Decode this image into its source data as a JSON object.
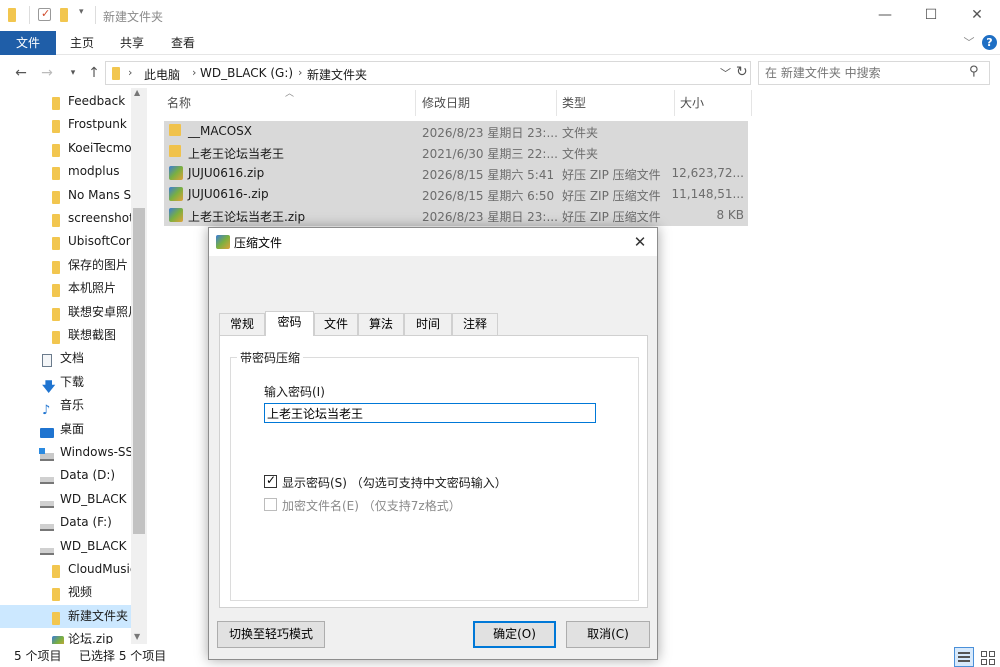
{
  "window": {
    "title": "新建文件夹",
    "controls": {
      "minimize": "—",
      "maximize": "☐",
      "close": "✕"
    }
  },
  "ribbon": {
    "tabs": [
      "文件",
      "主页",
      "共享",
      "查看"
    ],
    "collapse_glyph": "﹀",
    "help_glyph": "?"
  },
  "address": {
    "crumbs": [
      "此电脑",
      "WD_BLACK (G:)",
      "新建文件夹"
    ],
    "search_placeholder": "在 新建文件夹 中搜索"
  },
  "nav": {
    "items": [
      {
        "label": "Feedback",
        "icon": "folder-icon"
      },
      {
        "label": "Frostpunk",
        "icon": "folder-icon"
      },
      {
        "label": "KoeiTecmo",
        "icon": "folder-icon"
      },
      {
        "label": "modplus",
        "icon": "folder-icon"
      },
      {
        "label": "No Mans S",
        "icon": "folder-icon"
      },
      {
        "label": "screenshot",
        "icon": "folder-icon"
      },
      {
        "label": "UbisoftCor",
        "icon": "folder-icon"
      },
      {
        "label": "保存的图片",
        "icon": "folder-icon"
      },
      {
        "label": "本机照片",
        "icon": "folder-icon"
      },
      {
        "label": "联想安卓照片",
        "icon": "folder-icon"
      },
      {
        "label": "联想截图",
        "icon": "folder-icon"
      },
      {
        "label": "文档",
        "icon": "document-icon"
      },
      {
        "label": "下载",
        "icon": "download-icon"
      },
      {
        "label": "音乐",
        "icon": "music-icon"
      },
      {
        "label": "桌面",
        "icon": "desktop-icon"
      },
      {
        "label": "Windows-SSD",
        "icon": "windows-drive-icon"
      },
      {
        "label": "Data (D:)",
        "icon": "drive-icon"
      },
      {
        "label": "WD_BLACK (",
        "icon": "drive-icon"
      },
      {
        "label": "Data (F:)",
        "icon": "drive-icon"
      },
      {
        "label": "WD_BLACK (",
        "icon": "drive-icon"
      },
      {
        "label": "CloudMusic",
        "icon": "folder-icon"
      },
      {
        "label": "视频",
        "icon": "folder-icon"
      },
      {
        "label": "新建文件夹",
        "icon": "folder-icon",
        "selected": true
      },
      {
        "label": "论坛.zip",
        "icon": "zip-icon"
      }
    ]
  },
  "filelist": {
    "columns": [
      "名称",
      "修改日期",
      "类型",
      "大小"
    ],
    "rows": [
      {
        "name": "__MACOSX",
        "date": "2026/8/23 星期日 23:...",
        "type": "文件夹",
        "size": "",
        "icon": "folder-icon"
      },
      {
        "name": "上老王论坛当老王",
        "date": "2021/6/30 星期三 22:...",
        "type": "文件夹",
        "size": "",
        "icon": "folder-icon"
      },
      {
        "name": "JUJU0616.zip",
        "date": "2026/8/15 星期六 5:41",
        "type": "好压 ZIP 压缩文件",
        "size": "12,623,72...",
        "icon": "zip-icon"
      },
      {
        "name": "JUJU0616-.zip",
        "date": "2026/8/15 星期六 6:50",
        "type": "好压 ZIP 压缩文件",
        "size": "11,148,51...",
        "icon": "zip-icon"
      },
      {
        "name": "上老王论坛当老王.zip",
        "date": "2026/8/23 星期日 23:...",
        "type": "好压 ZIP 压缩文件",
        "size": "8 KB",
        "icon": "zip-icon"
      }
    ]
  },
  "status": {
    "count": "5 个项目",
    "selected": "已选择 5 个项目"
  },
  "dialog": {
    "title": "压缩文件",
    "tabs": [
      "常规",
      "密码",
      "文件",
      "算法",
      "时间",
      "注释"
    ],
    "active_tab": "密码",
    "group_title": "带密码压缩",
    "password_label": "输入密码(I)",
    "password_value": "上老王论坛当老王",
    "show_password_label": "显示密码(S) （勾选可支持中文密码输入）",
    "show_password_checked": true,
    "encrypt_names_label": "加密文件名(E) （仅支持7z格式）",
    "encrypt_names_checked": false,
    "encrypt_names_enabled": false,
    "btn_mode": "切换至轻巧模式",
    "btn_ok": "确定(O)",
    "btn_cancel": "取消(C)",
    "close_glyph": "✕"
  }
}
